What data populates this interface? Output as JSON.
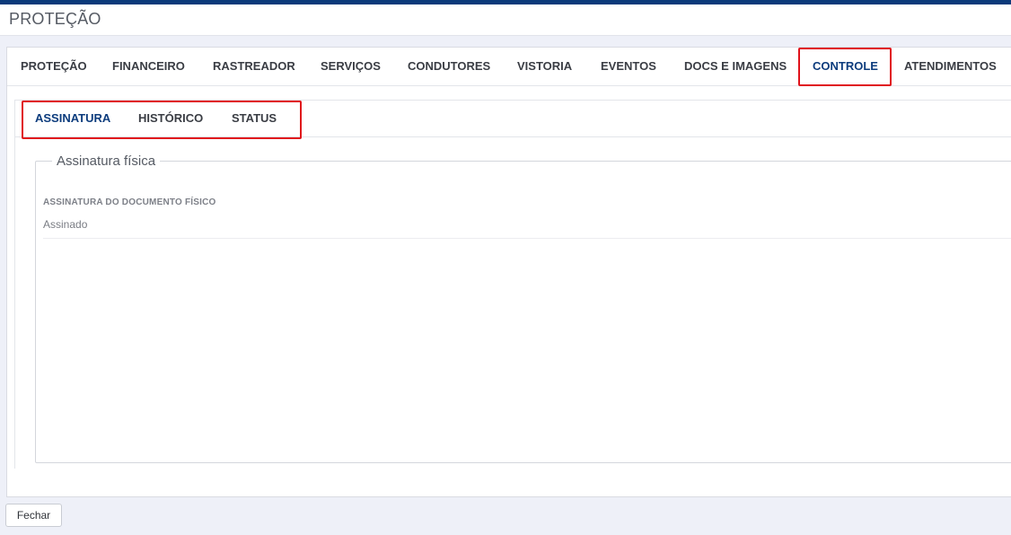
{
  "header": {
    "title": "PROTEÇÃO"
  },
  "main_tabs": [
    {
      "label": "PROTEÇÃO",
      "active": false
    },
    {
      "label": "FINANCEIRO",
      "active": false
    },
    {
      "label": "RASTREADOR",
      "active": false
    },
    {
      "label": "SERVIÇOS",
      "active": false
    },
    {
      "label": "CONDUTORES",
      "active": false
    },
    {
      "label": "VISTORIA",
      "active": false
    },
    {
      "label": "EVENTOS",
      "active": false
    },
    {
      "label": "DOCS E IMAGENS",
      "active": false
    },
    {
      "label": "CONTROLE",
      "active": true
    },
    {
      "label": "ATENDIMENTOS",
      "active": false
    }
  ],
  "sub_tabs": [
    {
      "label": "ASSINATURA",
      "active": true
    },
    {
      "label": "HISTÓRICO",
      "active": false
    },
    {
      "label": "STATUS",
      "active": false
    }
  ],
  "signature_section": {
    "legend": "Assinatura física",
    "field_label": "ASSINATURA DO DOCUMENTO FÍSICO",
    "field_value": "Assinado"
  },
  "footer": {
    "close_label": "Fechar"
  },
  "colors": {
    "accent": "#0b3a7a",
    "active_tab_text": "#0d3c7d",
    "highlight_box": "#e0121b",
    "background": "#eef0f8"
  }
}
